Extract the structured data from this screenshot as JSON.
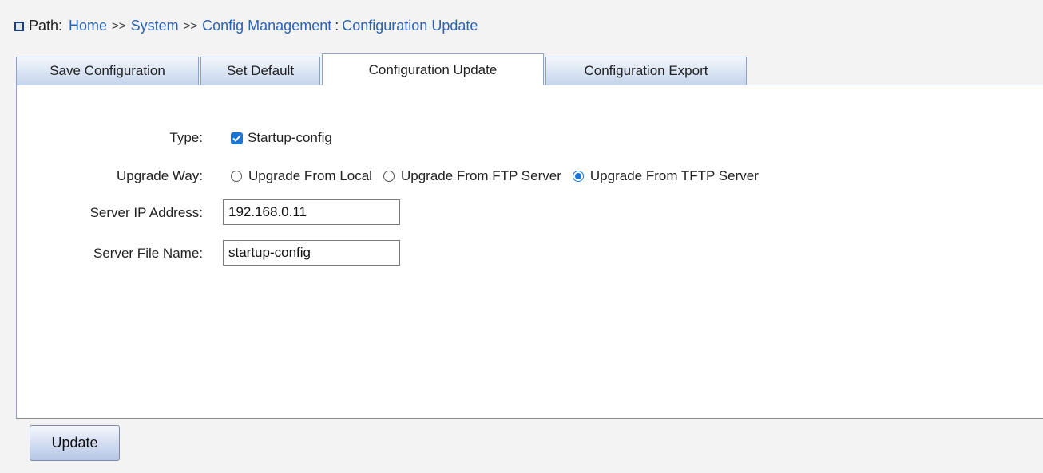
{
  "path": {
    "label": "Path:",
    "crumbs": [
      "Home",
      "System",
      "Config Management"
    ],
    "separator": ">>",
    "colon": ":",
    "current": "Configuration Update"
  },
  "tabs": [
    {
      "label": "Save Configuration",
      "active": false
    },
    {
      "label": "Set Default",
      "active": false
    },
    {
      "label": "Configuration Update",
      "active": true
    },
    {
      "label": "Configuration Export",
      "active": false
    }
  ],
  "form": {
    "type_label": "Type:",
    "type_option": "Startup-config",
    "type_checked": true,
    "upgrade_label": "Upgrade Way:",
    "upgrade_options": [
      {
        "label": "Upgrade From Local",
        "checked": false
      },
      {
        "label": "Upgrade From FTP Server",
        "checked": false
      },
      {
        "label": "Upgrade From TFTP Server",
        "checked": true
      }
    ],
    "server_ip_label": "Server IP Address:",
    "server_ip_value": "192.168.0.11",
    "server_file_label": "Server File Name:",
    "server_file_value": "startup-config"
  },
  "buttons": {
    "update_label": "Update"
  },
  "colors": {
    "link": "#2b64b3",
    "accent": "#1976d2",
    "tab_border": "#8da2c4"
  }
}
